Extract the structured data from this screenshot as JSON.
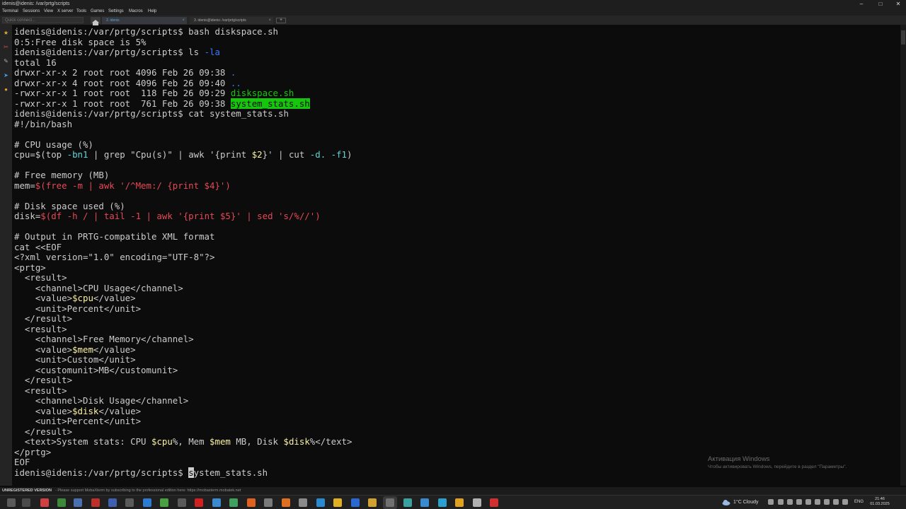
{
  "window": {
    "title": "idenis@idenis: /var/prtg/scripts"
  },
  "window_controls": {
    "minimize": "–",
    "maximize": "□",
    "close": "✕"
  },
  "menu": [
    "Terminal",
    "Sessions",
    "View",
    "X server",
    "Tools",
    "Games",
    "Settings",
    "Macros",
    "Help"
  ],
  "tabbar": {
    "quick_connect_placeholder": "Quick connect...",
    "tabs": [
      {
        "label": "2. idenis",
        "close": "×"
      },
      {
        "label": "3. idenis@idenis: /var/prtg/scripts",
        "close": "×"
      }
    ],
    "add_tab": "+"
  },
  "icons": {
    "sidebar": [
      "star-icon",
      "tools-icon",
      "macros-icon",
      "send-icon",
      "sftp-icon"
    ],
    "taskbar": [
      "start-icon",
      "search-icon",
      "terminal-icon",
      "files-icon",
      "store-icon",
      "browser-icon",
      "app-icon"
    ]
  },
  "terminal": {
    "lines": [
      [
        {
          "t": "idenis@idenis:/var/prtg/scripts$ bash diskspace.sh"
        }
      ],
      [
        {
          "t": "0:5:Free disk space is 5%"
        }
      ],
      [
        {
          "t": "idenis@idenis:/var/prtg/scripts$ ls "
        },
        {
          "t": "-la",
          "c": "c-blue"
        }
      ],
      [
        {
          "t": "total 16"
        }
      ],
      [
        {
          "t": "drwxr-xr-x 2 root root 4096 Feb 26 09:38 "
        },
        {
          "t": ".",
          "c": "c-blue"
        }
      ],
      [
        {
          "t": "drwxr-xr-x 4 root root 4096 Feb 26 09:40 "
        },
        {
          "t": "..",
          "c": "c-blue"
        }
      ],
      [
        {
          "t": "-rwxr-xr-x 1 root root  118 Feb 26 09:29 "
        },
        {
          "t": "diskspace.sh",
          "c": "c-green"
        }
      ],
      [
        {
          "t": "-rwxr-xr-x 1 root root  761 Feb 26 09:38 "
        },
        {
          "t": "system_stats.sh",
          "c": "hl-exec"
        }
      ],
      [
        {
          "t": "idenis@idenis:/var/prtg/scripts$ cat system_stats.sh"
        }
      ],
      [
        {
          "t": "#!/bin/bash"
        }
      ],
      [
        {
          "t": ""
        }
      ],
      [
        {
          "t": "# CPU usage (%)"
        }
      ],
      [
        {
          "t": "cpu=$(top "
        },
        {
          "t": "-bn1",
          "c": "c-cyan"
        },
        {
          "t": " | grep \"Cpu(s)\" | awk '{print "
        },
        {
          "t": "$2",
          "c": "c-var"
        },
        {
          "t": "}' | cut "
        },
        {
          "t": "-d.",
          "c": "c-cyan"
        },
        {
          "t": " "
        },
        {
          "t": "-f1",
          "c": "c-cyan"
        },
        {
          "t": ")"
        }
      ],
      [
        {
          "t": ""
        }
      ],
      [
        {
          "t": "# Free memory (MB)"
        }
      ],
      [
        {
          "t": "mem="
        },
        {
          "t": "$(free -m | awk '/^Mem:/ {print $4}')",
          "c": "c-red"
        }
      ],
      [
        {
          "t": ""
        }
      ],
      [
        {
          "t": "# Disk space used (%)"
        }
      ],
      [
        {
          "t": "disk="
        },
        {
          "t": "$(df -h / | tail -1 | awk '{print $5}' | sed 's/%//')",
          "c": "c-red"
        }
      ],
      [
        {
          "t": ""
        }
      ],
      [
        {
          "t": "# Output in PRTG-compatible XML format"
        }
      ],
      [
        {
          "t": "cat <<EOF"
        }
      ],
      [
        {
          "t": "<?xml version=\"1.0\" encoding=\"UTF-8\"?>"
        }
      ],
      [
        {
          "t": "<prtg>"
        }
      ],
      [
        {
          "t": "  <result>"
        }
      ],
      [
        {
          "t": "    <channel>CPU Usage</channel>"
        }
      ],
      [
        {
          "t": "    <value>"
        },
        {
          "t": "$cpu",
          "c": "c-var"
        },
        {
          "t": "</value>"
        }
      ],
      [
        {
          "t": "    <unit>Percent</unit>"
        }
      ],
      [
        {
          "t": "  </result>"
        }
      ],
      [
        {
          "t": "  <result>"
        }
      ],
      [
        {
          "t": "    <channel>Free Memory</channel>"
        }
      ],
      [
        {
          "t": "    <value>"
        },
        {
          "t": "$mem",
          "c": "c-var"
        },
        {
          "t": "</value>"
        }
      ],
      [
        {
          "t": "    <unit>Custom</unit>"
        }
      ],
      [
        {
          "t": "    <customunit>MB</customunit>"
        }
      ],
      [
        {
          "t": "  </result>"
        }
      ],
      [
        {
          "t": "  <result>"
        }
      ],
      [
        {
          "t": "    <channel>Disk Usage</channel>"
        }
      ],
      [
        {
          "t": "    <value>"
        },
        {
          "t": "$disk",
          "c": "c-var"
        },
        {
          "t": "</value>"
        }
      ],
      [
        {
          "t": "    <unit>Percent</unit>"
        }
      ],
      [
        {
          "t": "  </result>"
        }
      ],
      [
        {
          "t": "  <text>System stats: CPU "
        },
        {
          "t": "$cpu",
          "c": "c-var"
        },
        {
          "t": "%, Mem "
        },
        {
          "t": "$mem",
          "c": "c-var"
        },
        {
          "t": " MB, Disk "
        },
        {
          "t": "$disk",
          "c": "c-var"
        },
        {
          "t": "%</text>"
        }
      ],
      [
        {
          "t": "</prtg>"
        }
      ],
      [
        {
          "t": "EOF"
        }
      ],
      [
        {
          "t": "idenis@idenis:/var/prtg/scripts$ "
        },
        {
          "t": "s",
          "c": "cursor"
        },
        {
          "t": "ystem_stats.sh"
        }
      ]
    ]
  },
  "watermark": {
    "title": "Активация Windows",
    "subtitle": "Чтобы активировать Windows, перейдите в раздел \"Параметры\"."
  },
  "statusbar": {
    "registration": "UNREGISTERED VERSION",
    "message": " -  Please support MobaXterm by subscribing to the professional edition here:  https://mobaxterm.mobatek.net"
  },
  "taskbar": {
    "weather": "1°C  Cloudy",
    "language": "ENG",
    "time": "21:46",
    "date": "01.03.2025"
  },
  "colors": {
    "terminal_bg": "#0c0c0c",
    "terminal_fg": "#cccccc",
    "exec_highlight": "#16c60c",
    "option_blue": "#3b78ff",
    "string_red": "#e74856",
    "variable_yellow": "#f9f1a5"
  }
}
